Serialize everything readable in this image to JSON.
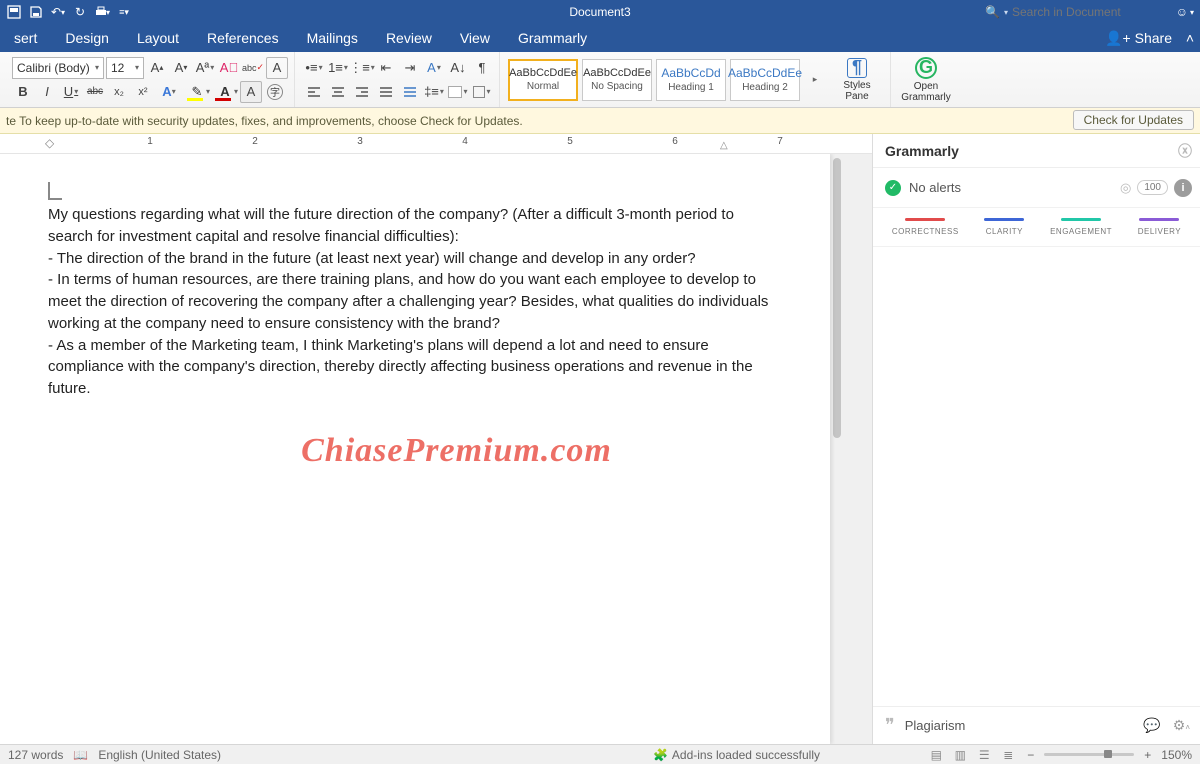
{
  "title": "Document3",
  "search_placeholder": "Search in Document",
  "share_label": "Share",
  "tabs": [
    "sert",
    "Design",
    "Layout",
    "References",
    "Mailings",
    "Review",
    "View",
    "Grammarly"
  ],
  "font": {
    "name": "Calibri (Body)",
    "size": "12"
  },
  "ribbon": {
    "bold": "B",
    "italic": "I",
    "underline": "U",
    "strike": "abc",
    "sub": "x₂",
    "sup": "x²",
    "clear": "A",
    "styles": [
      {
        "preview": "AaBbCcDdEe",
        "label": "Normal",
        "blue": false,
        "sel": true
      },
      {
        "preview": "AaBbCcDdEe",
        "label": "No Spacing",
        "blue": false,
        "sel": false
      },
      {
        "preview": "AaBbCcDd",
        "label": "Heading 1",
        "blue": true,
        "sel": false
      },
      {
        "preview": "AaBbCcDdEe",
        "label": "Heading 2",
        "blue": true,
        "sel": false
      }
    ],
    "styles_pane": "Styles\nPane",
    "open_grammarly": "Open\nGrammarly"
  },
  "update_msg": "te  To keep up-to-date with security updates, fixes, and improvements, choose Check for Updates.",
  "update_btn": "Check for Updates",
  "ruler_numbers": [
    "1",
    "2",
    "3",
    "4",
    "5",
    "6",
    "7"
  ],
  "document_text": [
    "My questions regarding what will the future direction of the company? (After a difficult 3-month period to search for investment capital and resolve financial difficulties):",
    "- The direction of the brand in the future (at least next year) will change and develop in any order?",
    "- In terms of human resources, are there training plans, and how do you want each employee to develop to meet the direction of recovering the company after a challenging year? Besides, what qualities do individuals working at the company need to ensure consistency with the brand?",
    "- As a member of the Marketing team, I think Marketing's plans will depend a lot and need to ensure compliance with the company's direction, thereby directly affecting business operations and revenue in the future."
  ],
  "watermark": "ChiasePremium.com",
  "grammarly": {
    "title": "Grammarly",
    "no_alerts": "No alerts",
    "score": "100",
    "categories": [
      {
        "label": "CORRECTNESS",
        "color": "#e14b4b"
      },
      {
        "label": "CLARITY",
        "color": "#3d66d6"
      },
      {
        "label": "ENGAGEMENT",
        "color": "#21c7a8"
      },
      {
        "label": "DELIVERY",
        "color": "#8a5bd6"
      }
    ],
    "plagiarism": "Plagiarism"
  },
  "status": {
    "words": "127 words",
    "lang": "English (United States)",
    "addins": "Add-ins loaded successfully",
    "zoom": "150%"
  }
}
